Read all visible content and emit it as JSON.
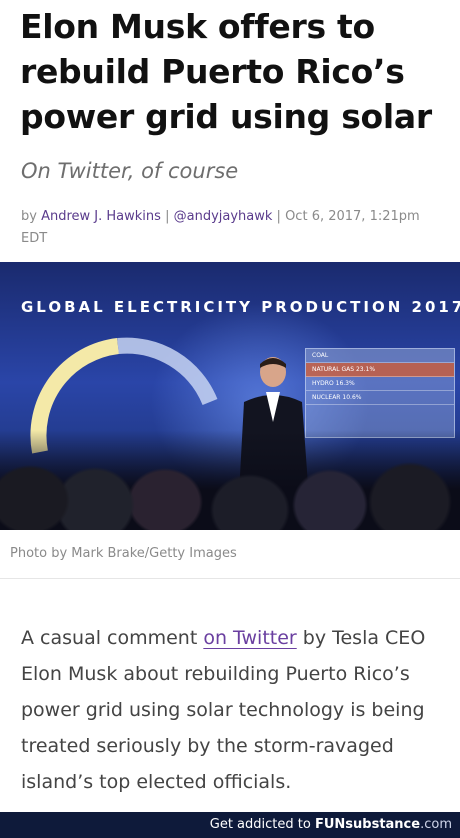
{
  "article": {
    "headline": "Elon Musk offers to rebuild Puerto Rico’s power grid using solar",
    "subtitle": "On Twitter, of course",
    "byline": {
      "by": "by",
      "author": "Andrew J. Hawkins",
      "handle": "@andyjayhawk",
      "date": "Oct 6, 2017, 1:21pm EDT"
    },
    "photo": {
      "screen_title": "GLOBAL ELECTRICITY PRODUCTION 2017",
      "screen_rows": [
        "COAL",
        "NATURAL GAS",
        "HYDRO",
        "NUCLEAR"
      ],
      "screen_values": [
        "",
        "23.1%",
        "16.3%",
        "10.6%"
      ]
    },
    "caption": "Photo by Mark Brake/Getty Images",
    "body": {
      "part1": "A casual comment ",
      "link": "on Twitter",
      "part2": " by Tesla CEO Elon Musk about rebuilding Puerto Rico’s power grid using solar technology is being treated seriously by the storm-ravaged island’s top elected officials."
    }
  },
  "footer": {
    "text": "Get addicted to ",
    "brand_a": "FUN",
    "brand_b": "substance",
    "brand_c": ".com"
  }
}
